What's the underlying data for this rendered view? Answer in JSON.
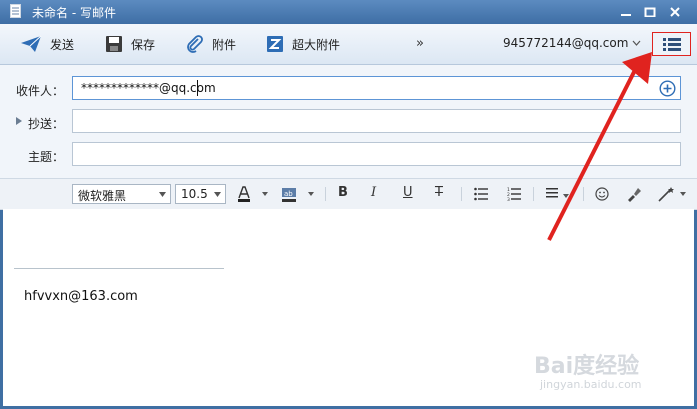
{
  "window": {
    "title": "未命名 - 写邮件"
  },
  "toolbar": {
    "send_label": "发送",
    "save_label": "保存",
    "attach_label": "附件",
    "big_attach_label": "超大附件",
    "more_label": "»",
    "account": "945772144@qq.com"
  },
  "fields": {
    "to_label": "收件人：",
    "to_value": "*************@qq.com",
    "cc_label": "抄送：",
    "subject_label": "主题："
  },
  "format": {
    "font_name": "微软雅黑",
    "font_size": "10.5",
    "bold": "B",
    "italic": "I",
    "underline": "U",
    "strike": "T"
  },
  "body": {
    "signature": "hfvvxn@163.com"
  },
  "watermark": {
    "brand": "Bai度经验",
    "url": "jingyan.baidu.com"
  },
  "colors": {
    "title_bar": "#4a7bb3",
    "accent": "#2e6db5",
    "highlight": "#e0231f"
  }
}
